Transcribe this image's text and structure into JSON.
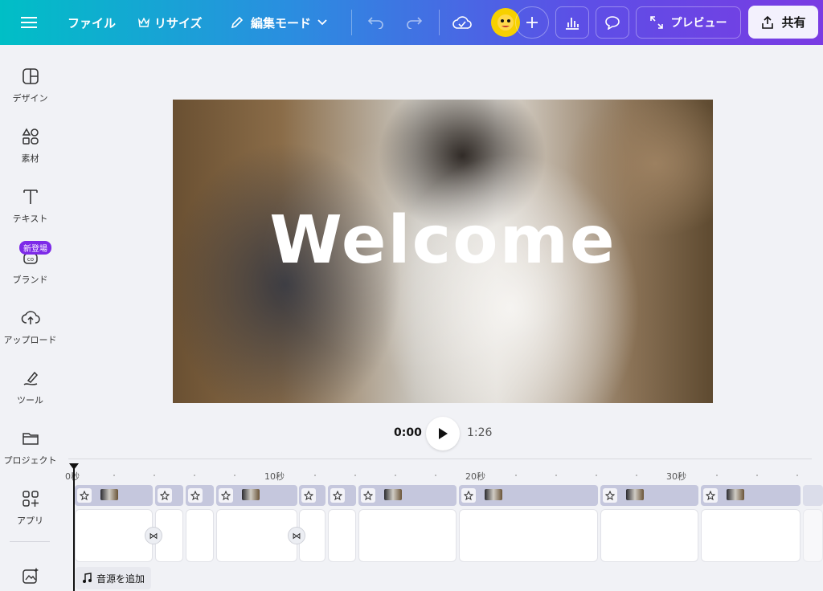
{
  "topbar": {
    "menu_icon": "hamburger-menu-icon",
    "file": "ファイル",
    "resize": "リサイズ",
    "edit_mode": "編集モード",
    "preview": "プレビュー",
    "share": "共有"
  },
  "sidebar": {
    "items": [
      {
        "label": "デザイン",
        "icon": "design-layout-icon"
      },
      {
        "label": "素材",
        "icon": "elements-shapes-icon"
      },
      {
        "label": "テキスト",
        "icon": "text-T-icon"
      },
      {
        "label": "ブランド",
        "icon": "brand-icon",
        "badge": "新登場"
      },
      {
        "label": "アップロード",
        "icon": "cloud-upload-icon"
      },
      {
        "label": "ツール",
        "icon": "draw-tool-icon"
      },
      {
        "label": "プロジェクト",
        "icon": "folder-icon"
      },
      {
        "label": "アプリ",
        "icon": "apps-grid-icon"
      }
    ]
  },
  "canvas": {
    "text": "Welcome"
  },
  "playback": {
    "current": "0:00",
    "total": "1:26"
  },
  "timeline": {
    "ruler": [
      "0秒",
      "10秒",
      "20秒",
      "30秒"
    ],
    "add_audio": "音源を追加"
  },
  "colors": {
    "accent": "#7d2ae8",
    "topbar_start": "#00bfc6",
    "topbar_end": "#7a3be3"
  }
}
